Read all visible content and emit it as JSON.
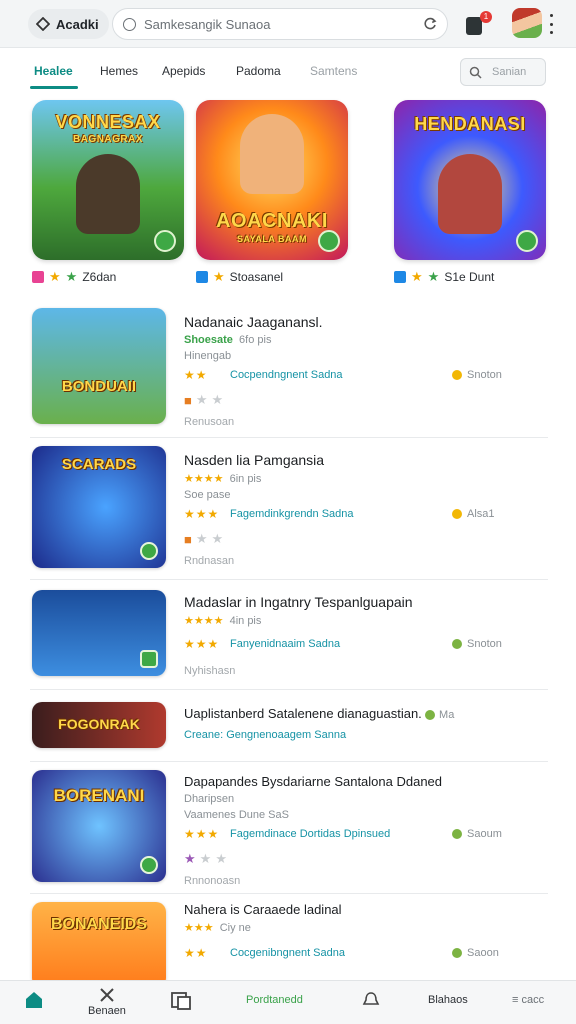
{
  "topbar": {
    "brand_label": "Acadki",
    "address_text": "Samkesangik Sunaoa",
    "notification_count": "1",
    "more_label": "⋮"
  },
  "tabs": {
    "items": [
      "Healee",
      "Hemes",
      "Apepids",
      "Padoma",
      "Samtens"
    ],
    "active_index": 0,
    "search_placeholder": "Sanian"
  },
  "featured": [
    {
      "title": "VONNESAX",
      "subtitle": "BAGNAGRAX",
      "meta": "Z6dan",
      "colors": [
        "#1f8a4c",
        "#9bd24a"
      ]
    },
    {
      "title": "AOACNAKI",
      "subtitle": "SAYALA BAAM",
      "meta": "Stoasanel",
      "colors": [
        "#ff7a1a",
        "#ffd23d"
      ]
    },
    {
      "title": "HENDANASI",
      "subtitle": "",
      "meta": "S1e Dunt",
      "colors": [
        "#1a3aa8",
        "#e84393"
      ]
    }
  ],
  "games": [
    {
      "title": "Nadanaic Jaaganansl.",
      "line1_green": "Shoesate",
      "line1_rest": "6fo pis",
      "line2": "Hinengab",
      "rating_stars": "★★",
      "link": "Cocpendngnent Sadna",
      "right_text": "Snoton",
      "right_dot": "#f2b705",
      "footer": "Renusoan",
      "thumb_title": "BONDUAII",
      "thumb_colors": [
        "#5db7e8",
        "#6ab04c"
      ]
    },
    {
      "title": "Nasden lia Pamgansia",
      "line1_green": "★★★★",
      "line1_rest": "6in pis",
      "line2": "Soe pase",
      "rating_stars": "★★★",
      "link": "Fagemdinkgrendn Sadna",
      "right_text": "Alsa1",
      "right_dot": "#f2b705",
      "footer": "Rndnasan",
      "thumb_title": "SCARADS",
      "thumb_colors": [
        "#1c2a8a",
        "#3b7bd9"
      ]
    },
    {
      "title": "Madaslar in Ingatnry Tespanlguapain",
      "line1_green": "★★★★",
      "line1_rest": "4in pis",
      "line2": "",
      "rating_stars": "★★★",
      "link": "Fanyenidnaaim Sadna",
      "right_text": "Snoton",
      "right_dot": "#7cb342",
      "footer": "Nyhishasn",
      "thumb_title": "",
      "thumb_colors": [
        "#1b4d9c",
        "#3d8ee0"
      ]
    },
    {
      "title": "Uaplistanberd Satalenene dianaguastian.",
      "line1_green": "",
      "line1_rest": "",
      "line2": "",
      "rating_stars": "",
      "link": "Creane: Gengnenoaagem Sanna",
      "right_text": "Ma",
      "right_dot": "#7cb342",
      "footer": "",
      "thumb_title": "FOGONRAK",
      "thumb_colors": [
        "#3a1d1d",
        "#b03a2e"
      ]
    },
    {
      "title": "Dapapandes Bysdariarne Santalona Ddaned",
      "line1_green": "",
      "line1_rest": "Dharipsen",
      "line2": "Vaamenes Dune SaS",
      "rating_stars": "★★★",
      "link": "Fagemdinace Dortidas Dpinsued",
      "right_text": "Saoum",
      "right_dot": "#7cb342",
      "footer": "Rnnonoasn",
      "thumb_title": "BORENANI",
      "thumb_colors": [
        "#2b2f8f",
        "#4fa3e3"
      ]
    },
    {
      "title": "Nahera is Caraaede ladinal",
      "line1_green": "★★★",
      "line1_rest": "Ciy ne",
      "line2": "",
      "rating_stars": "★★",
      "link": "Cocgenibngnent Sadna",
      "right_text": "Saoon",
      "right_dot": "#7cb342",
      "footer": "",
      "thumb_title": "BONANEIDS",
      "thumb_colors": [
        "#ff8a1f",
        "#ffd54a"
      ]
    }
  ],
  "bottom_nav": {
    "items": [
      "",
      "Benaen",
      "",
      "Pordtanedd",
      "",
      "Blahaos",
      "≡ cacc"
    ]
  },
  "colors": {
    "accent": "#0d8c84",
    "link": "#1693a5",
    "star": "#f2a900",
    "play": "#3ea845"
  }
}
